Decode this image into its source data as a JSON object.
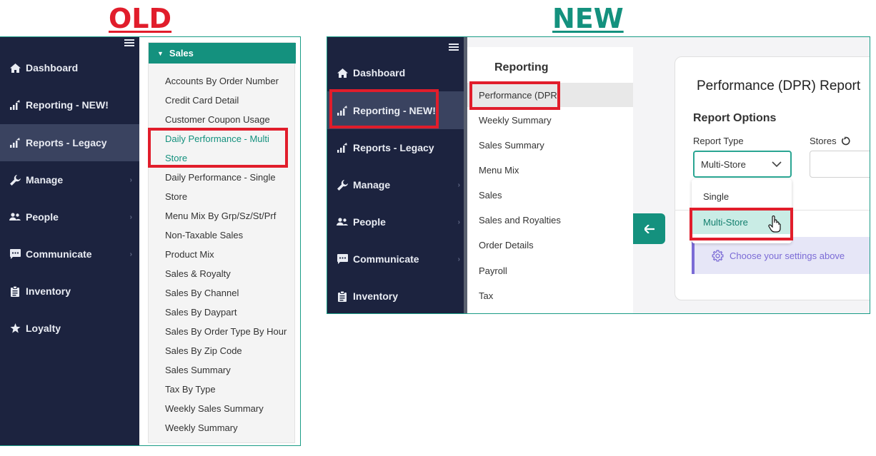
{
  "labels": {
    "old": "OLD",
    "new": "NEW"
  },
  "colors": {
    "sidebar_bg": "#1c233f",
    "accent": "#14917e",
    "highlight": "#e11d2b",
    "info": "#7b6bd6"
  },
  "old_panel": {
    "nav": [
      {
        "label": "Dashboard",
        "icon": "home-icon",
        "chevron": false
      },
      {
        "label": "Reporting - NEW!",
        "icon": "chart-up-icon",
        "chevron": false
      },
      {
        "label": "Reports - Legacy",
        "icon": "chart-up-icon",
        "chevron": false,
        "active": true
      },
      {
        "label": "Manage",
        "icon": "wrench-icon",
        "chevron": true
      },
      {
        "label": "People",
        "icon": "people-icon",
        "chevron": true
      },
      {
        "label": "Communicate",
        "icon": "chat-icon",
        "chevron": true
      },
      {
        "label": "Inventory",
        "icon": "clipboard-icon",
        "chevron": false
      },
      {
        "label": "Loyalty",
        "icon": "star-icon",
        "chevron": false
      }
    ],
    "section_title": "Sales",
    "reports": [
      "Accounts By Order Number",
      "Credit Card Detail",
      "Customer Coupon Usage",
      "Daily Performance - Multi",
      "Store",
      "Daily Performance - Single",
      "Store",
      "Menu Mix By Grp/Sz/St/Prf",
      "Non-Taxable Sales",
      "Product Mix",
      "Sales & Royalty",
      "Sales By Channel",
      "Sales By Daypart",
      "Sales By Order Type By Hour",
      "Sales By Zip Code",
      "Sales Summary",
      "Tax By Type",
      "Weekly Sales Summary",
      "Weekly Summary"
    ]
  },
  "new_panel": {
    "nav": [
      {
        "label": "Dashboard",
        "icon": "home-icon",
        "chevron": false
      },
      {
        "label": "Reporting - NEW!",
        "icon": "chart-up-icon",
        "chevron": false,
        "active": true
      },
      {
        "label": "Reports - Legacy",
        "icon": "chart-up-icon",
        "chevron": false
      },
      {
        "label": "Manage",
        "icon": "wrench-icon",
        "chevron": true
      },
      {
        "label": "People",
        "icon": "people-icon",
        "chevron": true
      },
      {
        "label": "Communicate",
        "icon": "chat-icon",
        "chevron": true
      },
      {
        "label": "Inventory",
        "icon": "clipboard-icon",
        "chevron": false
      }
    ],
    "submenu_title": "Reporting",
    "submenu": [
      "Performance (DPR)",
      "Weekly Summary",
      "Sales Summary",
      "Menu Mix",
      "Sales",
      "Sales and Royalties",
      "Order Details",
      "Payroll",
      "Tax"
    ],
    "report_title": "Performance (DPR) Report",
    "options_title": "Report Options",
    "report_type_label": "Report Type",
    "stores_label": "Stores",
    "report_type_value": "Multi-Store",
    "dropdown_options": [
      "Single",
      "Multi-Store"
    ],
    "info_text": "Choose your settings above"
  }
}
